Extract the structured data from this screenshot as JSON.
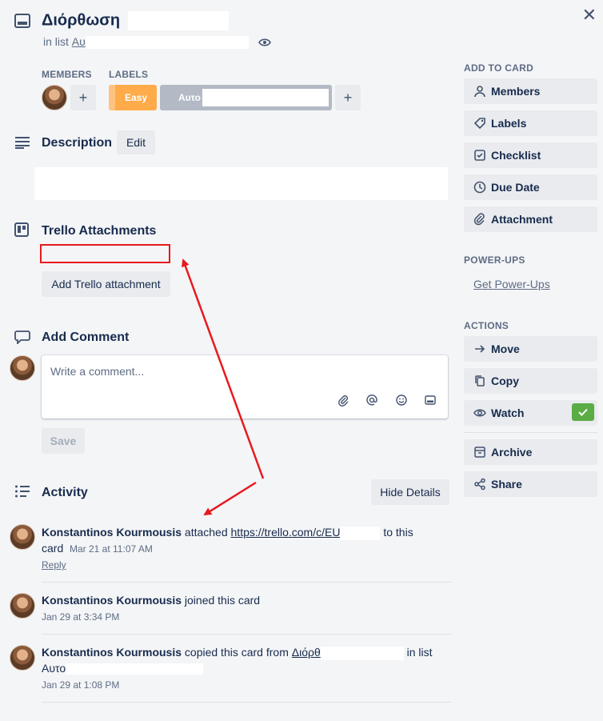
{
  "header": {
    "card_title": "Διόρθωση",
    "in_list_prefix": "in list",
    "list_name": "Αυ"
  },
  "members": {
    "label": "MEMBERS"
  },
  "labels": {
    "label": "LABELS",
    "items": [
      {
        "text": "Easy",
        "color": "#ffab4a"
      },
      {
        "text": "Αυτο",
        "color": "#b3bac5"
      }
    ]
  },
  "description": {
    "title": "Description",
    "edit_label": "Edit"
  },
  "trello_attachments": {
    "title": "Trello Attachments",
    "add_label": "Add Trello attachment"
  },
  "comment": {
    "title": "Add Comment",
    "placeholder": "Write a comment...",
    "save_label": "Save"
  },
  "activity": {
    "title": "Activity",
    "hide_details_label": "Hide Details",
    "items": [
      {
        "user": "Konstantinos Kourmousis",
        "action": "attached",
        "link": "https://trello.com/c/EU",
        "suffix": "to this card",
        "time": "Mar 21 at 11:07 AM",
        "reply": "Reply"
      },
      {
        "user": "Konstantinos Kourmousis",
        "action": "joined this card",
        "time": "Jan 29 at 3:34 PM"
      },
      {
        "user": "Konstantinos Kourmousis",
        "action": "copied this card from",
        "link": "Διόρθ",
        "suffix": "in list",
        "list": "Αυτο",
        "time": "Jan 29 at 1:08 PM"
      }
    ]
  },
  "sidebar": {
    "add_to_card": {
      "heading": "ADD TO CARD",
      "buttons": [
        "Members",
        "Labels",
        "Checklist",
        "Due Date",
        "Attachment"
      ]
    },
    "power_ups": {
      "heading": "POWER-UPS",
      "link": "Get Power-Ups"
    },
    "actions": {
      "heading": "ACTIONS",
      "buttons": [
        "Move",
        "Copy",
        "Watch",
        "Archive",
        "Share"
      ]
    }
  },
  "colors": {
    "annotation_red": "#e8191f",
    "watch_check_green": "#5aac44",
    "label_orange": "#ffab4a",
    "label_gray": "#b3bac5"
  }
}
